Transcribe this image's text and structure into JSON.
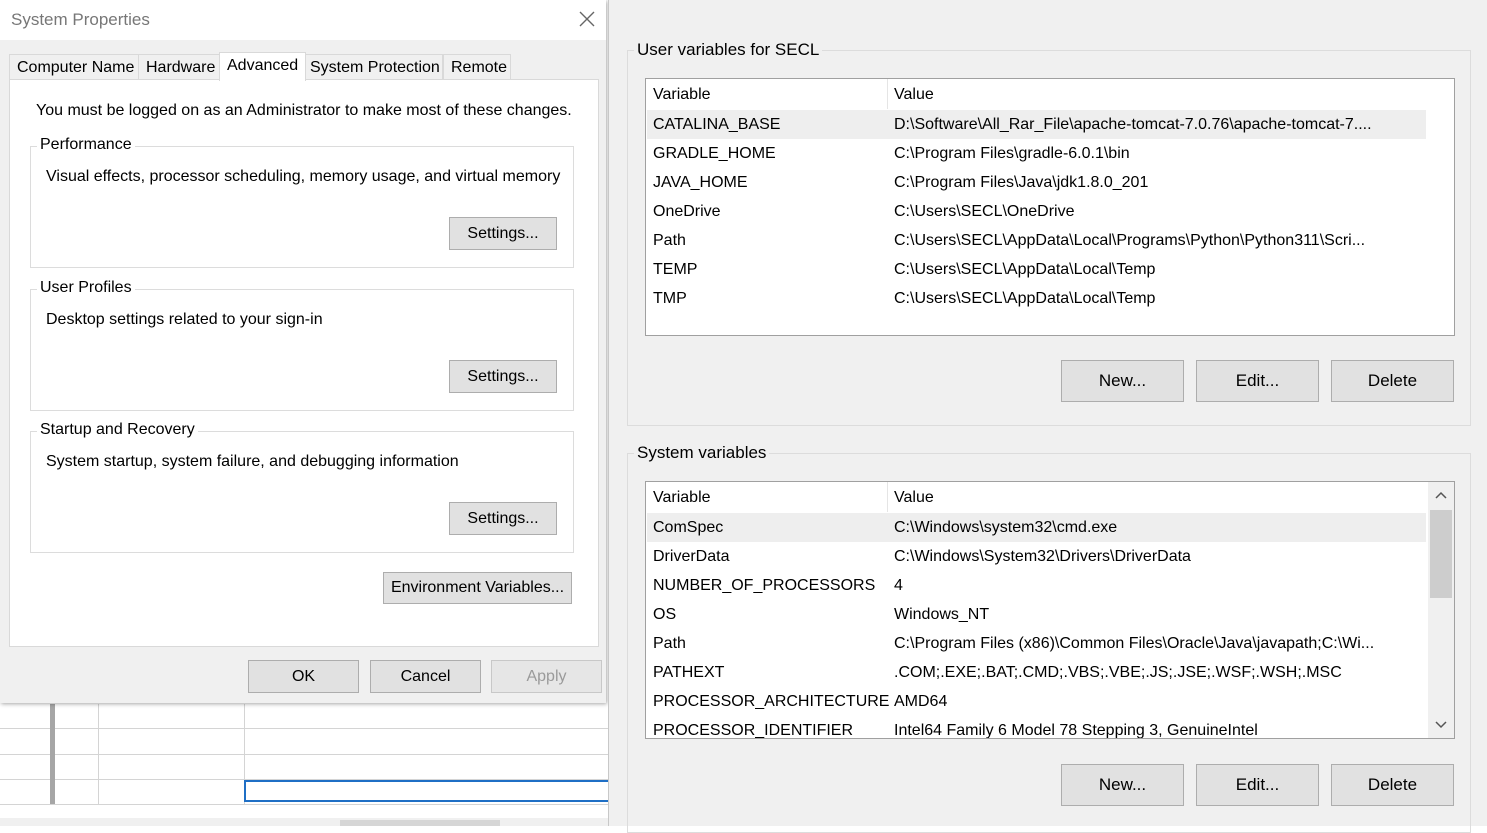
{
  "system_properties": {
    "title": "System Properties",
    "tabs": [
      {
        "label": "Computer Name"
      },
      {
        "label": "Hardware"
      },
      {
        "label": "Advanced"
      },
      {
        "label": "System Protection"
      },
      {
        "label": "Remote"
      }
    ],
    "active_tab": "Advanced",
    "admin_note": "You must be logged on as an Administrator to make most of these changes.",
    "performance": {
      "label": "Performance",
      "description": "Visual effects, processor scheduling, memory usage, and virtual memory",
      "button": "Settings..."
    },
    "user_profiles": {
      "label": "User Profiles",
      "description": "Desktop settings related to your sign-in",
      "button": "Settings..."
    },
    "startup_recovery": {
      "label": "Startup and Recovery",
      "description": "System startup, system failure, and debugging information",
      "button": "Settings..."
    },
    "env_button": "Environment Variables...",
    "footer": {
      "ok": "OK",
      "cancel": "Cancel",
      "apply": "Apply"
    }
  },
  "environment_variables": {
    "user_section": {
      "label": "User variables for SECL",
      "columns": [
        "Variable",
        "Value"
      ],
      "rows": [
        {
          "variable": "CATALINA_BASE",
          "value": "D:\\Software\\All_Rar_File\\apache-tomcat-7.0.76\\apache-tomcat-7...."
        },
        {
          "variable": "GRADLE_HOME",
          "value": "C:\\Program Files\\gradle-6.0.1\\bin"
        },
        {
          "variable": "JAVA_HOME",
          "value": "C:\\Program Files\\Java\\jdk1.8.0_201"
        },
        {
          "variable": "OneDrive",
          "value": "C:\\Users\\SECL\\OneDrive"
        },
        {
          "variable": "Path",
          "value": "C:\\Users\\SECL\\AppData\\Local\\Programs\\Python\\Python311\\Scri..."
        },
        {
          "variable": "TEMP",
          "value": "C:\\Users\\SECL\\AppData\\Local\\Temp"
        },
        {
          "variable": "TMP",
          "value": "C:\\Users\\SECL\\AppData\\Local\\Temp"
        }
      ],
      "buttons": {
        "new": "New...",
        "edit": "Edit...",
        "delete": "Delete"
      }
    },
    "system_section": {
      "label": "System variables",
      "columns": [
        "Variable",
        "Value"
      ],
      "rows": [
        {
          "variable": "ComSpec",
          "value": "C:\\Windows\\system32\\cmd.exe"
        },
        {
          "variable": "DriverData",
          "value": "C:\\Windows\\System32\\Drivers\\DriverData"
        },
        {
          "variable": "NUMBER_OF_PROCESSORS",
          "value": "4"
        },
        {
          "variable": "OS",
          "value": "Windows_NT"
        },
        {
          "variable": "Path",
          "value": "C:\\Program Files (x86)\\Common Files\\Oracle\\Java\\javapath;C:\\Wi..."
        },
        {
          "variable": "PATHEXT",
          "value": ".COM;.EXE;.BAT;.CMD;.VBS;.VBE;.JS;.JSE;.WSF;.WSH;.MSC"
        },
        {
          "variable": "PROCESSOR_ARCHITECTURE",
          "value": "AMD64"
        },
        {
          "variable": "PROCESSOR_IDENTIFIER",
          "value": "Intel64 Family 6 Model 78 Stepping 3, GenuineIntel"
        }
      ],
      "buttons": {
        "new": "New...",
        "edit": "Edit...",
        "delete": "Delete"
      }
    }
  },
  "colors": {
    "selection_border": "#1f6fc5",
    "row_highlight": "#eeeeee",
    "dialog_bg": "#f0f0f0"
  }
}
